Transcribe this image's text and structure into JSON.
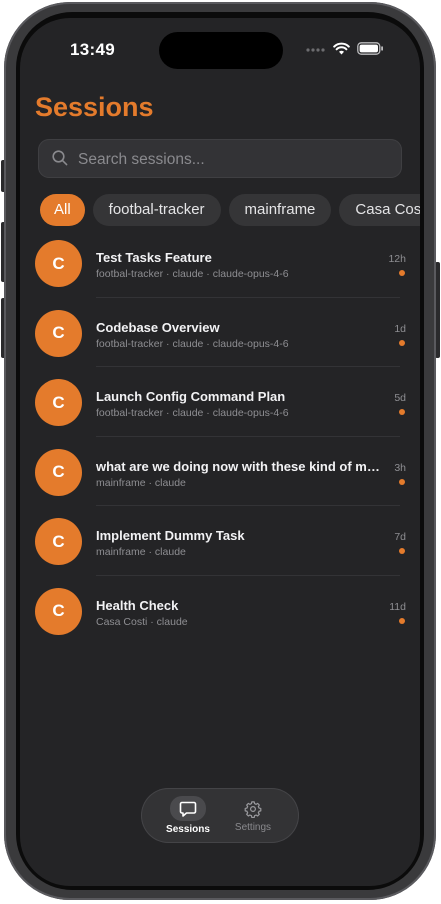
{
  "status": {
    "time": "13:49"
  },
  "header": {
    "title": "Sessions"
  },
  "search": {
    "placeholder": "Search sessions..."
  },
  "filters": [
    "All",
    "footbal-tracker",
    "mainframe",
    "Casa Costi"
  ],
  "sessions": [
    {
      "initial": "C",
      "title": "Test Tasks Feature",
      "subtitle": "footbal-tracker · claude · claude-opus-4-6",
      "time": "12h"
    },
    {
      "initial": "C",
      "title": "Codebase Overview",
      "subtitle": "footbal-tracker · claude · claude-opus-4-6",
      "time": "1d"
    },
    {
      "initial": "C",
      "title": "Launch Config Command Plan",
      "subtitle": "footbal-tracker · claude · claude-opus-4-6",
      "time": "5d"
    },
    {
      "initial": "C",
      "title": "what are we doing now with these kind of mes...",
      "subtitle": "mainframe · claude",
      "time": "3h"
    },
    {
      "initial": "C",
      "title": "Implement Dummy Task",
      "subtitle": "mainframe · claude",
      "time": "7d"
    },
    {
      "initial": "C",
      "title": "Health Check",
      "subtitle": "Casa Costi · claude",
      "time": "11d"
    }
  ],
  "tabbar": {
    "sessions_label": "Sessions",
    "settings_label": "Settings"
  },
  "colors": {
    "accent": "#e47b2c",
    "background": "#242426"
  }
}
